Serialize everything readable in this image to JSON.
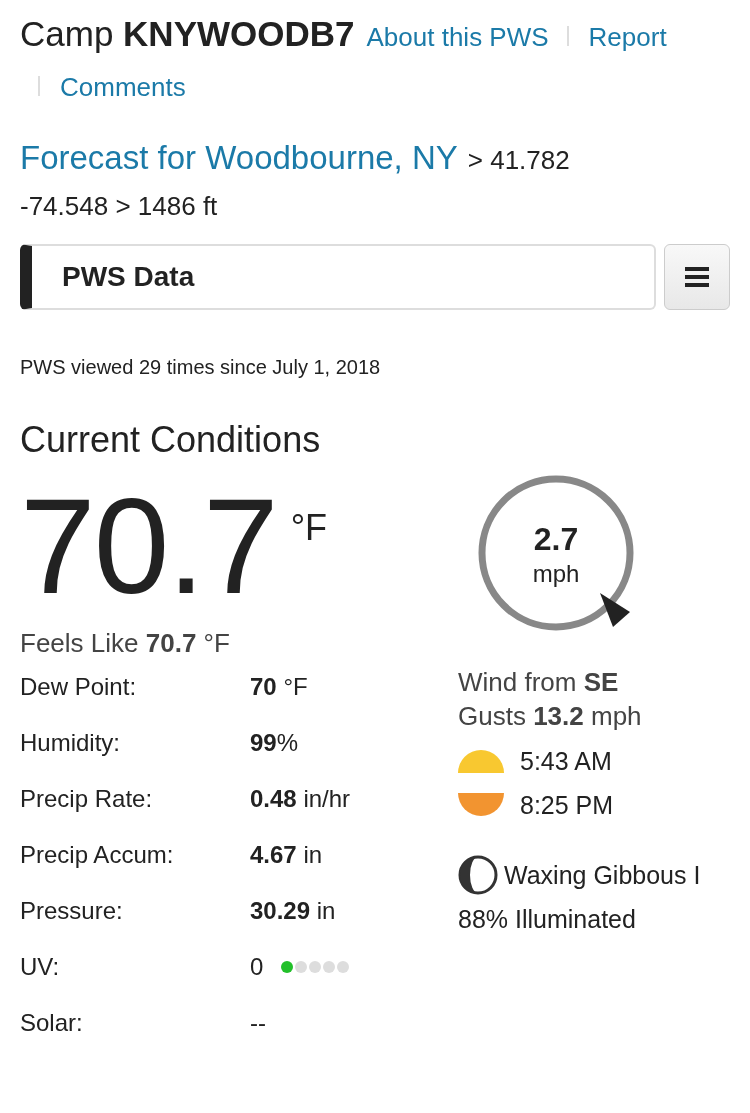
{
  "station": {
    "title": "Camp **KNYWOODB7**",
    "links": [
      "About this PWS",
      "Report",
      "Comments"
    ]
  },
  "forecast": {
    "link": "Forecast for Woodbourne, NY",
    "coords": [
      "> 41.782",
      "-74.548 > 1486 ft"
    ]
  },
  "section_bar": {
    "title": "PWS Data"
  },
  "views": "PWS viewed 29 times since July 1, 2018",
  "conditions": {
    "heading": "Current Conditions",
    "temperature": "70.7",
    "temp_unit": "°F",
    "feels_like": {
      "label": "Feels Like",
      "value": "70.7",
      "unit": "°F"
    },
    "rows": [
      {
        "kind": "value",
        "label": "Dew Point:",
        "value": "70",
        "unit": "°F"
      },
      {
        "kind": "value",
        "label": "Humidity:",
        "value": "99",
        "unit": "%"
      },
      {
        "kind": "value",
        "label": "Precip Rate:",
        "value": "0.48",
        "unit": "in/hr"
      },
      {
        "kind": "value",
        "label": "Precip Accum:",
        "value": "4.67",
        "unit": "in"
      },
      {
        "kind": "value",
        "label": "Pressure:",
        "value": "30.29",
        "unit": "in"
      },
      {
        "kind": "uv",
        "label": "UV:",
        "value": "0",
        "dots": [
          {
            "on": true
          },
          {
            "on": false
          },
          {
            "on": false
          },
          {
            "on": false
          },
          {
            "on": false
          }
        ]
      },
      {
        "kind": "plain",
        "label": "Solar:",
        "value": "--"
      }
    ]
  },
  "wind": {
    "speed": "2.7",
    "unit": "mph",
    "from_label": "Wind from",
    "direction": "SE",
    "gusts_label": "Gusts",
    "gusts": "13.2",
    "gusts_unit": "mph"
  },
  "sun": [
    {
      "kind": "sunrise",
      "time": "5:43 AM"
    },
    {
      "kind": "sunset",
      "time": "8:25 PM"
    }
  ],
  "moon": {
    "phase": "Waxing Gibbous I",
    "illuminated": "88% Illuminated"
  }
}
